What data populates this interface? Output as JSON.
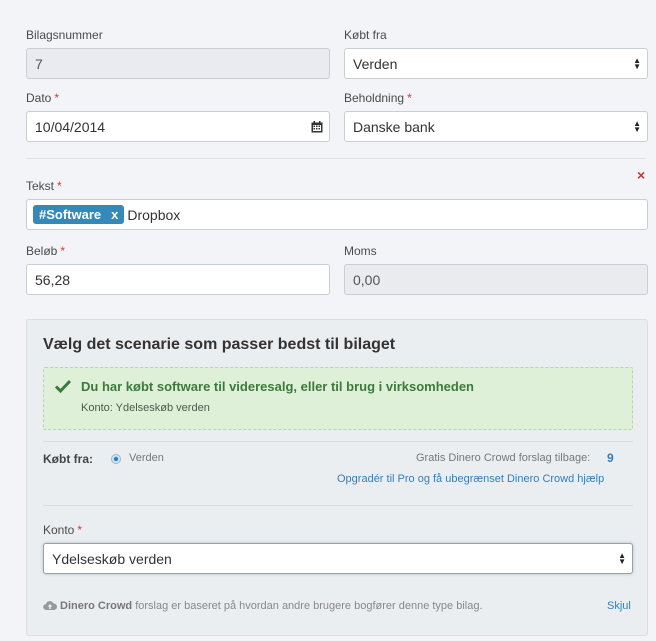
{
  "form": {
    "bilagsnummer": {
      "label": "Bilagsnummer",
      "value": "7"
    },
    "kobt_fra": {
      "label": "Købt fra",
      "value": "Verden"
    },
    "dato": {
      "label": "Dato",
      "required": "*",
      "value": "10/04/2014"
    },
    "beholdning": {
      "label": "Beholdning",
      "required": "*",
      "value": "Danske bank"
    },
    "tekst": {
      "label": "Tekst",
      "required": "*",
      "tag": "#Software",
      "tag_remove": "x",
      "text": "Dropbox"
    },
    "clear": "×",
    "belob": {
      "label": "Beløb",
      "required": "*",
      "value": "56,28"
    },
    "moms": {
      "label": "Moms",
      "value": "0,00"
    }
  },
  "scenario": {
    "heading": "Vælg det scenarie som passer bedst til bilaget",
    "selected_title": "Du har købt software til videresalg, eller til brug i virksomheden",
    "selected_account": "Konto: Ydelseskøb verden",
    "kobt_fra_label": "Købt fra:",
    "kobt_fra_value": "Verden",
    "crowd_left_text": "Gratis Dinero Crowd forslag tilbage:",
    "crowd_left_count": "9",
    "upgrade_link": "Opgradér til Pro og få ubegrænset Dinero Crowd hjælp",
    "konto_label": "Konto",
    "konto_required": "*",
    "konto_value": "Ydelseskøb verden",
    "footer_brand": "Dinero Crowd",
    "footer_text": "forslag er baseret på hvordan andre brugere bogfører denne type bilag.",
    "hide_link": "Skjul"
  },
  "colors": {
    "accent": "#3489b8",
    "success_text": "#3c7a3a",
    "link": "#2f7fbf",
    "required": "#d9392f"
  },
  "icons": [
    "calendar-icon",
    "select-arrows-icon",
    "close-icon",
    "checkmark-icon",
    "globe-icon",
    "cloud-upload-icon"
  ]
}
